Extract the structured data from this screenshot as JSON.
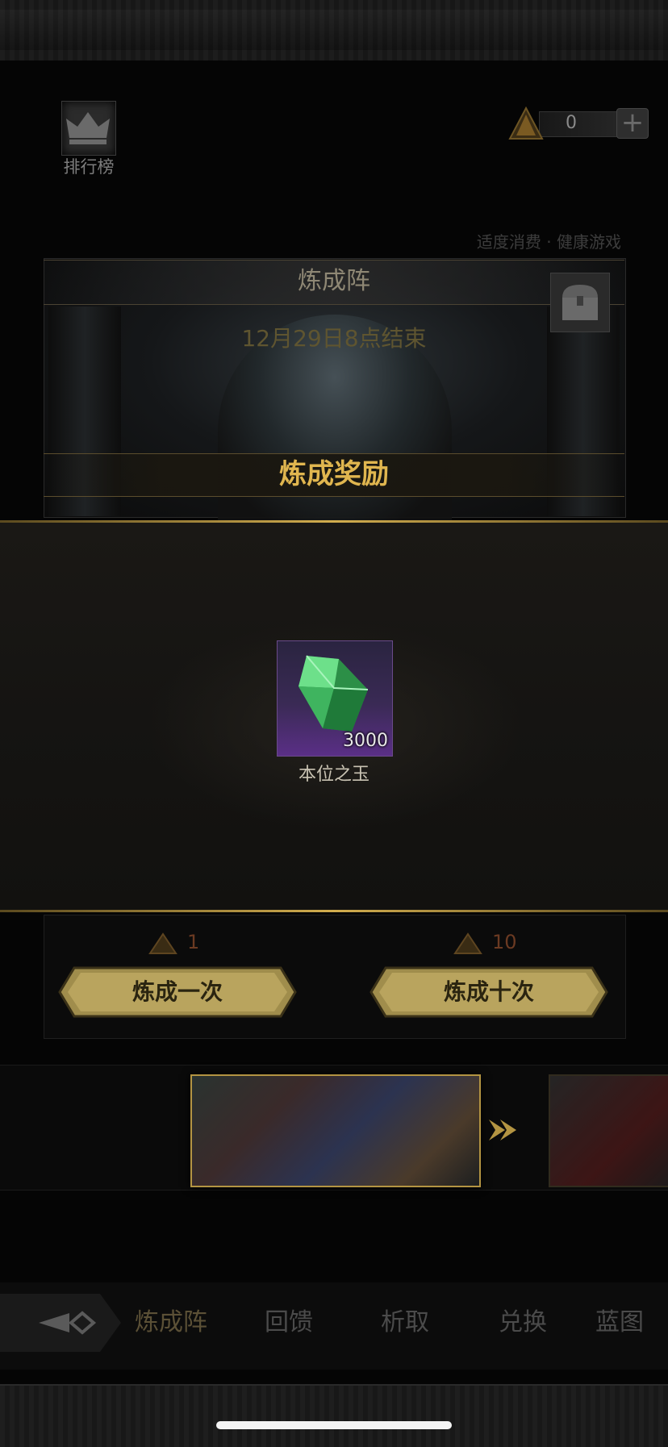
{
  "header": {
    "rank_label": "排行榜",
    "currency_value": "0",
    "plus_symbol": "+",
    "notice": "适度消费 · 健康游戏"
  },
  "panel": {
    "title": "炼成阵",
    "end_time": "12月29日8点结束",
    "reward_title": "炼成奖励"
  },
  "reward_item": {
    "name": "本位之玉",
    "quantity": "3000",
    "icon": "green-crystal-icon"
  },
  "actions": {
    "single_cost": "1",
    "ten_cost": "10",
    "single_label": "炼成一次",
    "ten_label": "炼成十次"
  },
  "tabs": [
    {
      "label": "炼成阵"
    },
    {
      "label": "回馈"
    },
    {
      "label": "析取"
    },
    {
      "label": "兑换"
    },
    {
      "label": "蓝图"
    }
  ],
  "colors": {
    "gold": "#d2ad4e",
    "reward_title": "#e0b64f",
    "item_purple": "#5a2f86"
  }
}
